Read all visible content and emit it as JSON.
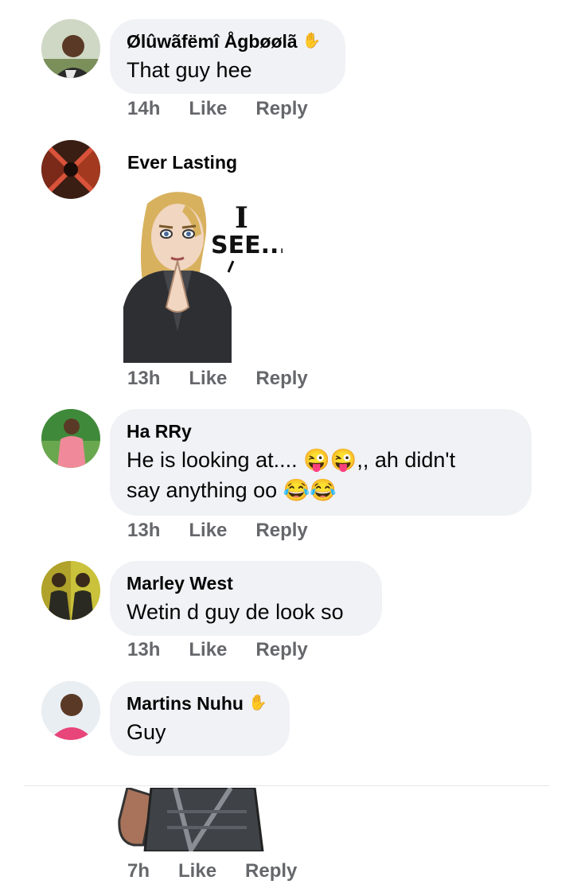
{
  "comments": [
    {
      "name": "Ølûwãfëmî Ågbøølã",
      "has_badge": true,
      "text": "That guy hee",
      "time": "14h",
      "like": "Like",
      "reply": "Reply"
    },
    {
      "name": "Ever Lasting",
      "sticker_text": "I SEE...",
      "time": "13h",
      "like": "Like",
      "reply": "Reply"
    },
    {
      "name": "Ha RRy",
      "text_line1": "He is looking at.... 😜😜,, ah didn't",
      "text_line2": "say anything oo 😂😂",
      "time": "13h",
      "like": "Like",
      "reply": "Reply"
    },
    {
      "name": "Marley West",
      "text": "Wetin d guy de look so",
      "time": "13h",
      "like": "Like",
      "reply": "Reply"
    },
    {
      "name": "Martins Nuhu",
      "has_badge": true,
      "text": "Guy"
    }
  ],
  "bottom_comment": {
    "time": "7h",
    "like": "Like",
    "reply": "Reply"
  },
  "icons": {
    "badge": "waving-hand-icon"
  },
  "colors": {
    "bubble": "#f0f2f5",
    "meta": "#65676b",
    "text": "#050505"
  }
}
